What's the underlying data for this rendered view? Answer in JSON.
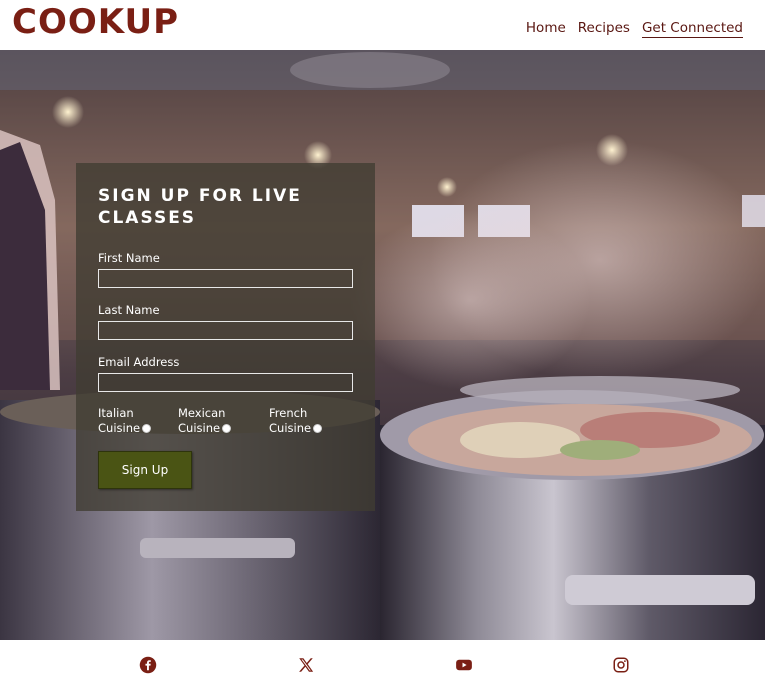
{
  "brand": {
    "logo": "COOKUP"
  },
  "nav": {
    "items": [
      {
        "label": "Home"
      },
      {
        "label": "Recipes"
      },
      {
        "label": "Get Connected"
      }
    ]
  },
  "signup": {
    "title": "SIGN UP FOR LIVE CLASSES",
    "first_name_label": "First Name",
    "first_name_value": "",
    "last_name_label": "Last Name",
    "last_name_value": "",
    "email_label": "Email Address",
    "email_value": "",
    "cuisines": [
      {
        "line1": "Italian",
        "line2": "Cuisine"
      },
      {
        "line1": "Mexican",
        "line2": "Cuisine"
      },
      {
        "line1": "French",
        "line2": "Cuisine"
      }
    ],
    "button_label": "Sign Up"
  },
  "footer": {
    "icons": [
      "facebook-icon",
      "x-twitter-icon",
      "youtube-icon",
      "instagram-icon"
    ],
    "icon_color": "#7a1f14"
  },
  "colors": {
    "brand": "#7a1f14",
    "button": "#4a5414"
  }
}
